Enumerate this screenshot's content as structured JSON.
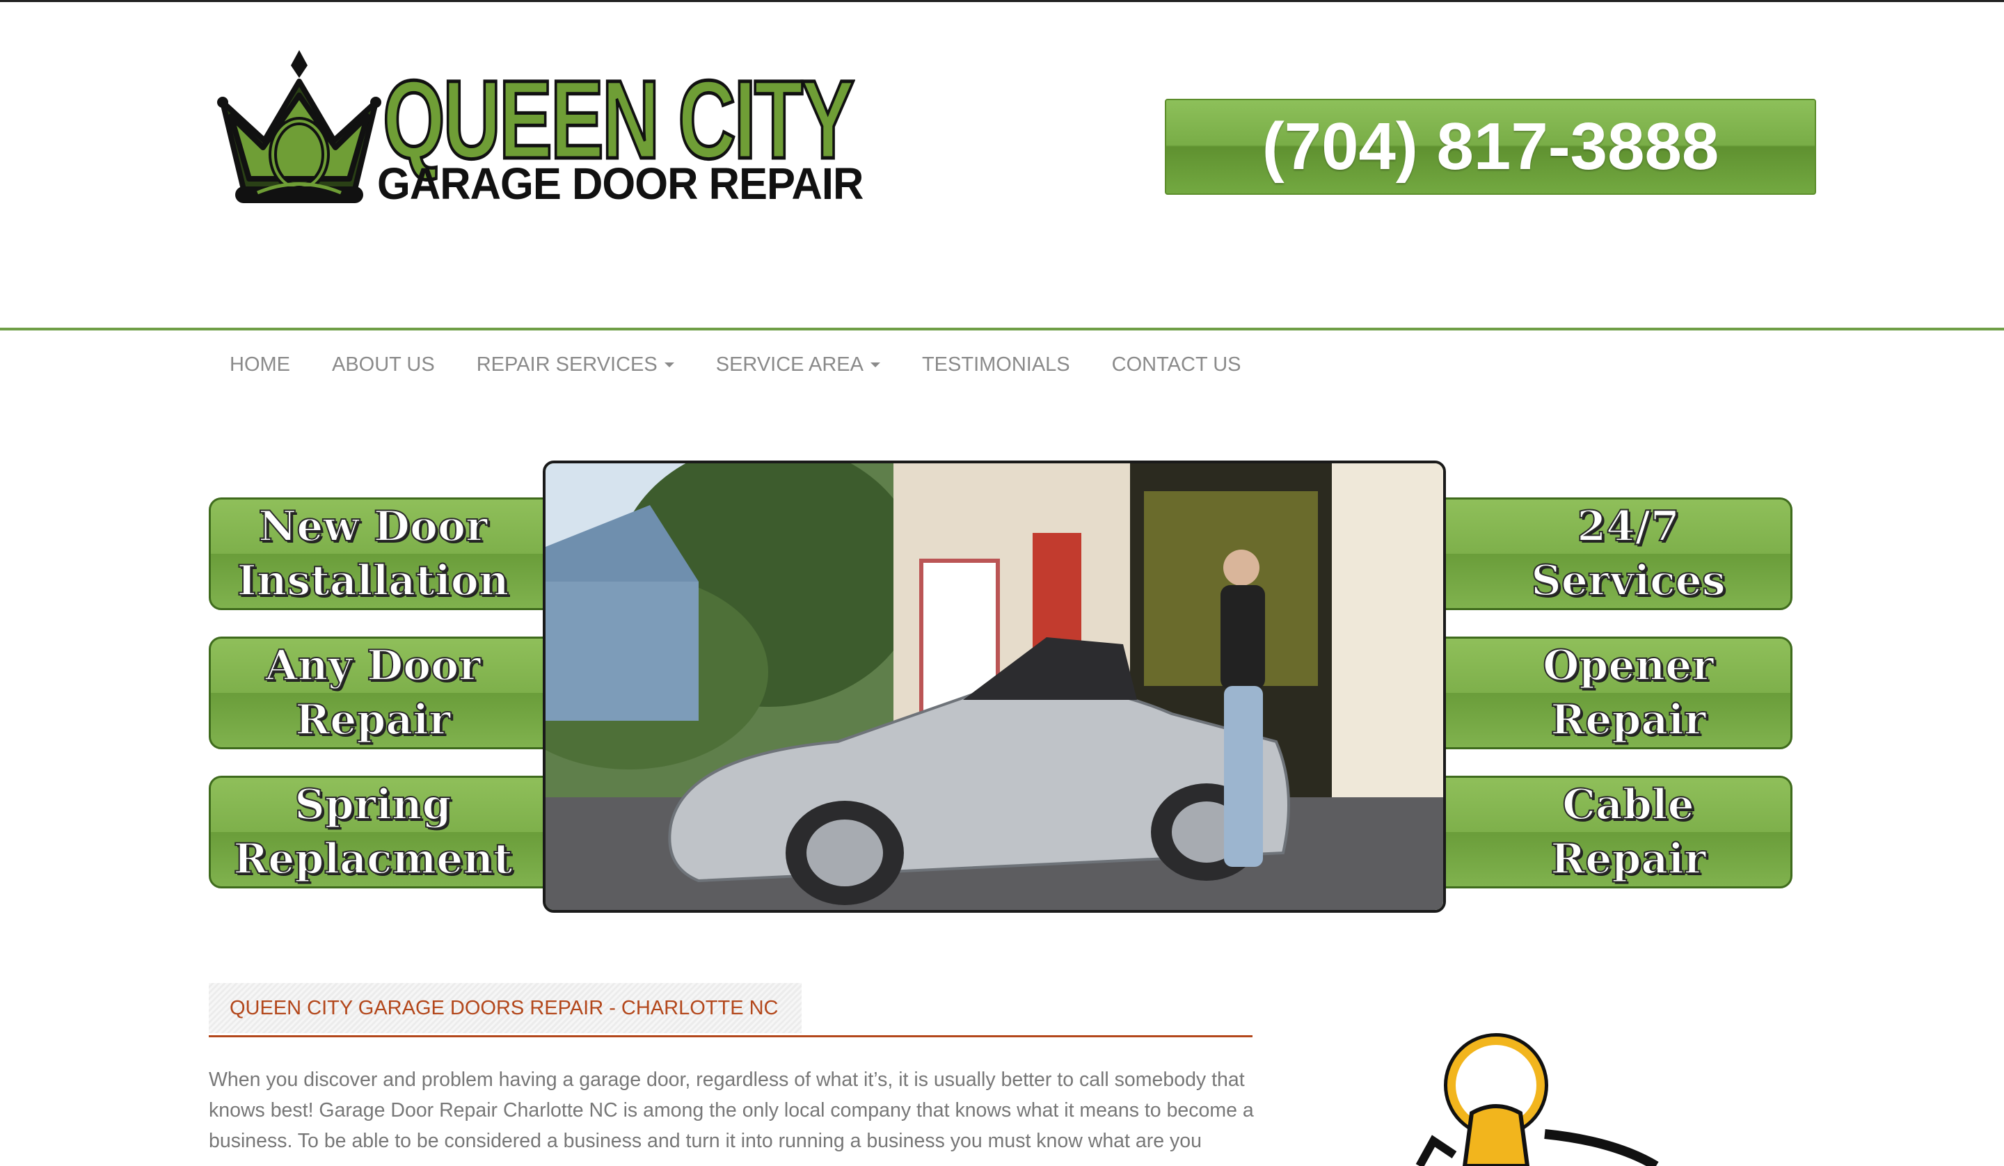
{
  "brand": {
    "title": "QUEEN CITY",
    "subtitle": "GARAGE DOOR REPAIR",
    "colors": {
      "green": "#6f9e36",
      "dark": "#111111"
    }
  },
  "header": {
    "phone": "(704) 817-3888"
  },
  "nav": {
    "items": [
      {
        "label": "HOME"
      },
      {
        "label": "ABOUT US"
      },
      {
        "label": "REPAIR SERVICES",
        "dropdown": true
      },
      {
        "label": "SERVICE AREA",
        "dropdown": true
      },
      {
        "label": "TESTIMONIALS"
      },
      {
        "label": "CONTACT US"
      }
    ]
  },
  "services": {
    "left": [
      {
        "label": "New Door\nInstallation"
      },
      {
        "label": "Any Door\nRepair"
      },
      {
        "label": "Spring\nReplacment"
      }
    ],
    "right": [
      {
        "label": "24/7\nServices"
      },
      {
        "label": "Opener\nRepair"
      },
      {
        "label": "Cable\nRepair"
      }
    ]
  },
  "main": {
    "heading": "QUEEN CITY GARAGE DOORS REPAIR - CHARLOTTE NC",
    "intro": "When you discover and problem having a garage door, regardless of what it’s, it is usually better to call somebody that knows best! Garage Door Repair Charlotte NC is among the only local company that knows what it means to become a business. To be able to be considered a business and turn it into running a business you must know what are you"
  },
  "accent": {
    "heading_color": "#b3471b",
    "nav_rule": "#6f9e47"
  }
}
